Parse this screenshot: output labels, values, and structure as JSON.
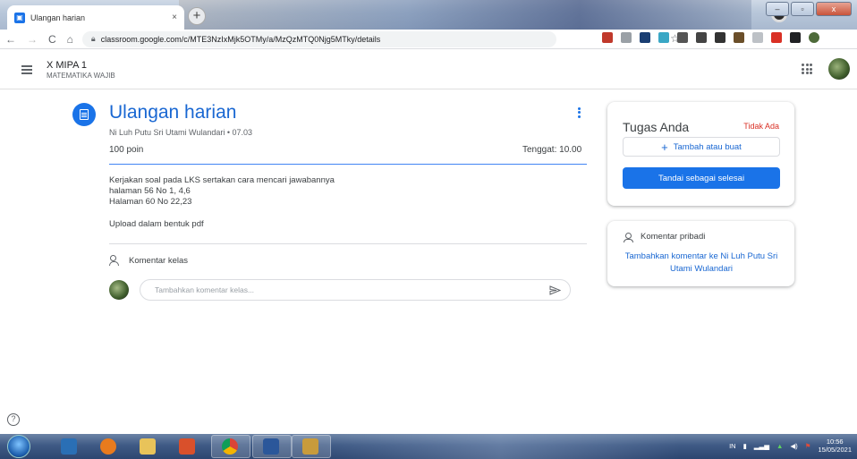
{
  "browser": {
    "tab_title": "Ulangan harian",
    "tab_close": "×",
    "new_tab": "+",
    "url": "classroom.google.com/c/MTE3NzIxMjk5OTMy/a/MzQzMTQ0Njg5MTky/details",
    "window_controls": {
      "minimize": "–",
      "maximize": "▫",
      "close": "x"
    }
  },
  "appbar": {
    "class_name": "X MIPA 1",
    "class_section": "MATEMATIKA WAJIB"
  },
  "assignment": {
    "title": "Ulangan harian",
    "meta": "Ni Luh Putu Sri Utami Wulandari • 07.03",
    "points": "100 poin",
    "due": "Tenggat: 10.00",
    "instructions": [
      "Kerjakan soal pada LKS sertakan cara mencari jawabannya",
      "halaman 56 No 1, 4,6",
      "Halaman 60 No 22,23"
    ],
    "note": "Upload dalam bentuk pdf",
    "class_comments_label": "Komentar kelas",
    "comment_placeholder": "Tambahkan komentar kelas..."
  },
  "your_work": {
    "heading": "Tugas Anda",
    "status": "Tidak Ada",
    "add_button": "Tambah atau buat",
    "mark_done_button": "Tandai sebagai selesai",
    "status_color": "#d93025",
    "accent": "#1a73e8"
  },
  "private_comments": {
    "heading": "Komentar pribadi",
    "link": "Tambahkan komentar ke Ni Luh Putu Sri Utami Wulandari"
  },
  "help_icon": "?",
  "taskbar": {
    "lang": "IN",
    "time": "10:56",
    "date": "15/05/2021"
  }
}
